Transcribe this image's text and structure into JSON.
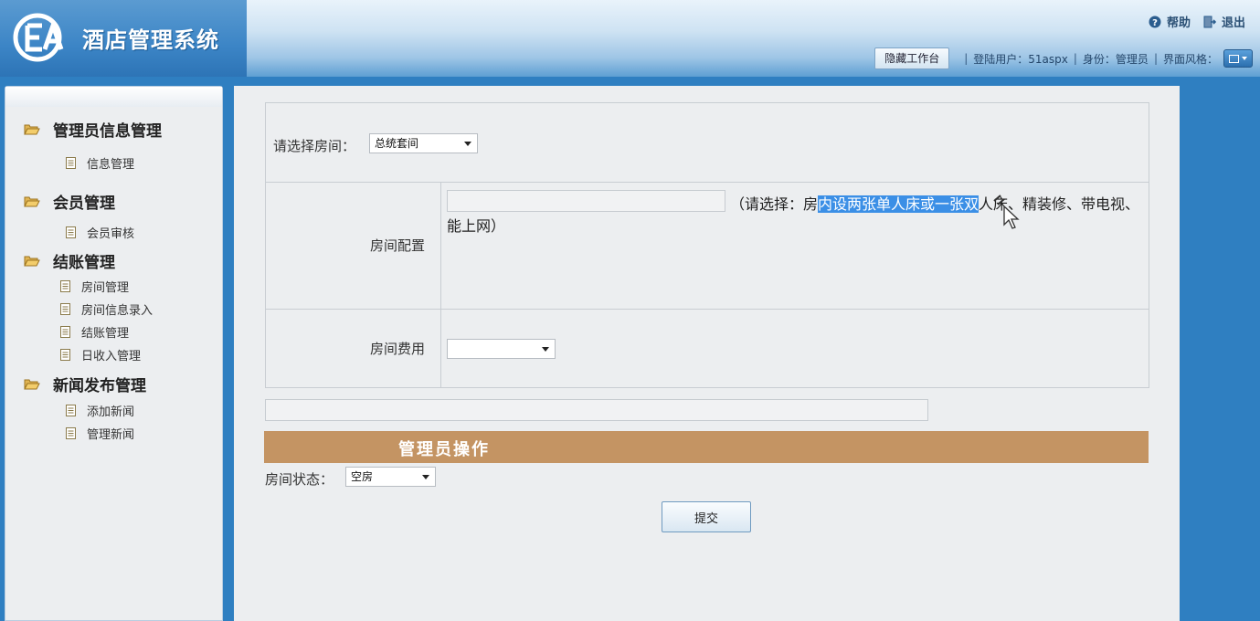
{
  "header": {
    "app_title": "酒店管理系统",
    "help_label": "帮助",
    "logout_label": "退出",
    "hide_workbench_label": "隐藏工作台",
    "login_user_text": "登陆用户：51aspx",
    "identity_text": "身份：管理员",
    "ui_style_label": "界面风格："
  },
  "sidebar": {
    "groups": [
      {
        "label": "管理员信息管理",
        "items": [
          "信息管理"
        ]
      },
      {
        "label": "会员管理",
        "items": [
          "会员审核"
        ]
      },
      {
        "label": "结账管理",
        "items": [
          "房间管理",
          "房间信息录入",
          "结账管理",
          "日收入管理"
        ]
      },
      {
        "label": "新闻发布管理",
        "items": [
          "添加新闻",
          "管理新闻"
        ]
      }
    ]
  },
  "form": {
    "select_room_label": "请选择房间：",
    "select_room_value": "总统套间",
    "room_config_label": "房间配置",
    "room_config_hint_pre": "（请选择：房",
    "room_config_hint_selected": "内设两张单人床或一张双",
    "room_config_hint_post": "人床、精装修、带电视、能上网）",
    "room_fee_label": "房间费用",
    "room_fee_value": ""
  },
  "admin": {
    "section_title": "管理员操作",
    "room_status_label": "房间状态：",
    "room_status_value": "空房",
    "submit_label": "提交"
  },
  "colors": {
    "header_blue": "#3c85c6",
    "section_bar": "#c49463",
    "selection_highlight": "#3b8fe6"
  }
}
